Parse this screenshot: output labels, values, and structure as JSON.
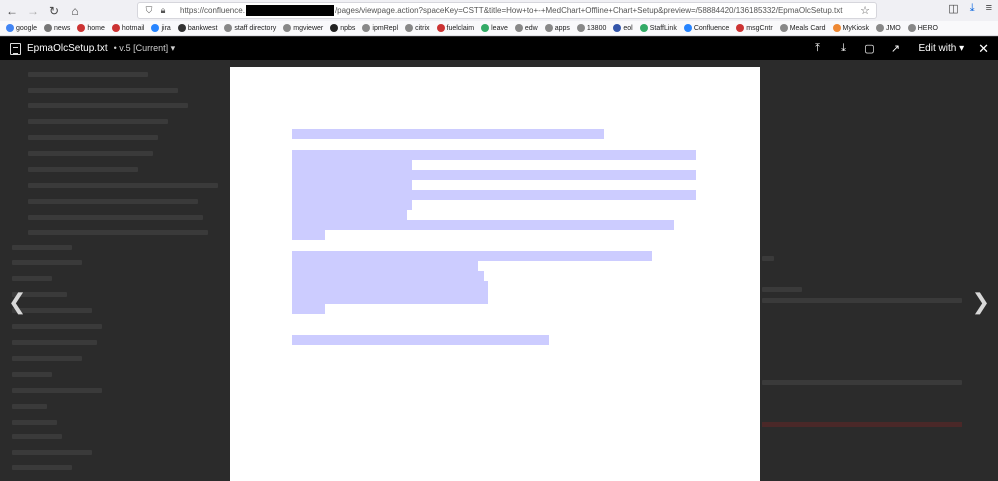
{
  "browser": {
    "url_prefix": "https://confluence.",
    "url_suffix": "/pages/viewpage.action?spaceKey=CSTT&title=How+to+-+MedChart+Offline+Chart+Setup&preview=/58884420/136185332/EpmaOlcSetup.txt",
    "bookmarks": [
      "google",
      "news",
      "home",
      "hotmail",
      "jira",
      "bankwest",
      "staff directory",
      "mgviewer",
      "npbs",
      "ipmRepl",
      "citrix",
      "fuelclaim",
      "leave",
      "edw",
      "apps",
      "13800",
      "eol",
      "StaffLink",
      "Confluence",
      "msgCntr",
      "Meals Card",
      "MyKiosk",
      "JMO",
      "HERO"
    ]
  },
  "preview": {
    "file_name": "EpmaOlcSetup.txt",
    "version": "• v.5 [Current] ▾",
    "edit_with_label": "Edit with ▾",
    "icons": [
      "upload-icon",
      "download-icon",
      "comment-icon",
      "share-icon",
      "close-icon",
      "previous-arrow-icon",
      "next-arrow-icon"
    ]
  }
}
